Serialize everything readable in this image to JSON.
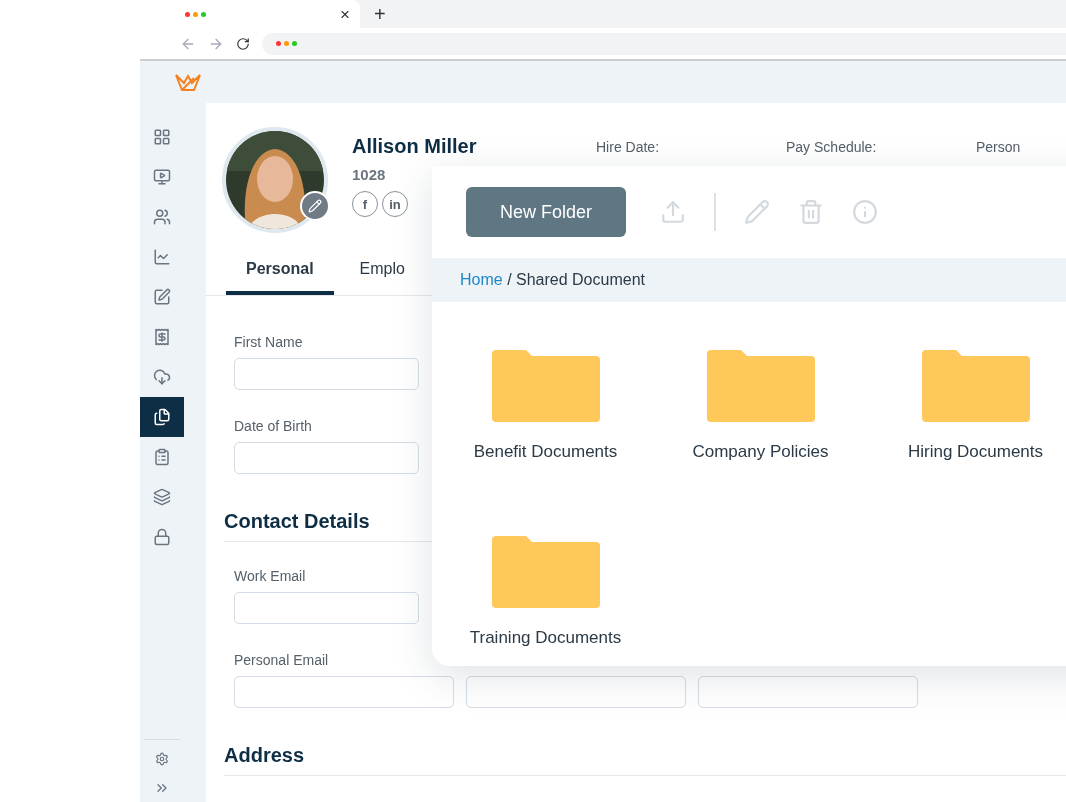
{
  "browser": {
    "tab_close": "×",
    "tab_new": "+"
  },
  "sidebar": {
    "items": [
      {
        "selected": false
      },
      {
        "selected": false
      },
      {
        "selected": false
      },
      {
        "selected": false
      },
      {
        "selected": false
      },
      {
        "selected": false
      },
      {
        "selected": false
      },
      {
        "selected": true
      },
      {
        "selected": false
      },
      {
        "selected": false
      },
      {
        "selected": false
      }
    ]
  },
  "profile": {
    "name": "Allison Miller",
    "employee_id": "1028",
    "social": [
      "f",
      "in"
    ],
    "facts": [
      "Hire Date:",
      "Pay Schedule:",
      "Person"
    ]
  },
  "tabs": [
    {
      "label": "Personal",
      "selected": true
    },
    {
      "label": "Emplo",
      "selected": false
    }
  ],
  "form": [
    {
      "kind": "field",
      "label": "First Name"
    },
    {
      "kind": "field",
      "label": "Date of Birth"
    },
    {
      "kind": "heading",
      "label": "Contact Details"
    },
    {
      "kind": "field",
      "label": "Work Email"
    },
    {
      "kind": "triple",
      "label": "Personal Email"
    },
    {
      "kind": "heading",
      "label": "Address"
    }
  ],
  "documents": {
    "new_folder": "New Folder",
    "tools": [
      {
        "kind": "upload",
        "disabled": true
      },
      {
        "kind": "divider",
        "disabled": true
      },
      {
        "kind": "edit",
        "disabled": true
      },
      {
        "kind": "delete",
        "disabled": true
      },
      {
        "kind": "info",
        "disabled": true
      }
    ],
    "breadcrumb": {
      "link": "Home",
      "rest": " / Shared Document"
    },
    "folders": [
      {
        "name": "Benefit Documents"
      },
      {
        "name": "Company Policies"
      },
      {
        "name": "Hiring Documents"
      },
      {
        "name": "Training Documents"
      }
    ]
  }
}
